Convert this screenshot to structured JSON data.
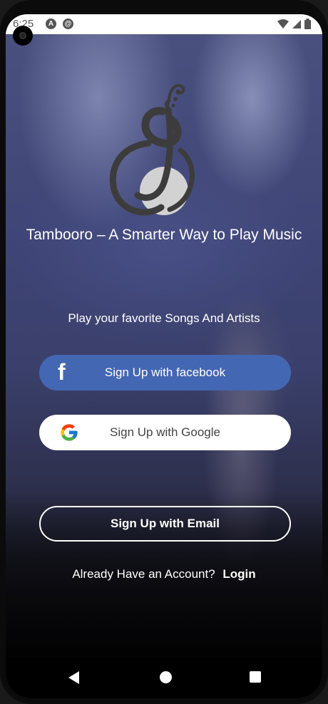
{
  "status_bar": {
    "time": "6:25",
    "icons": [
      "a-icon",
      "sync-icon",
      "wifi-icon",
      "cellular-icon",
      "battery-icon"
    ]
  },
  "app": {
    "tagline": "Tambooro – A Smarter Way to Play Music",
    "subtitle": "Play your favorite Songs And Artists"
  },
  "buttons": {
    "facebook_label": "Sign Up with facebook",
    "google_label": "Sign Up with Google",
    "email_label": "Sign Up with Email"
  },
  "footer": {
    "prompt": "Already Have an Account?",
    "login_label": "Login"
  },
  "nav_bar": {
    "icons": [
      "back-icon",
      "home-icon",
      "recents-icon"
    ]
  },
  "colors": {
    "facebook_button": "#4467b3",
    "google_button": "#ffffff",
    "text": "#ffffff",
    "logo_dark": "#3c3c3c",
    "logo_light": "#d0d0d0"
  }
}
